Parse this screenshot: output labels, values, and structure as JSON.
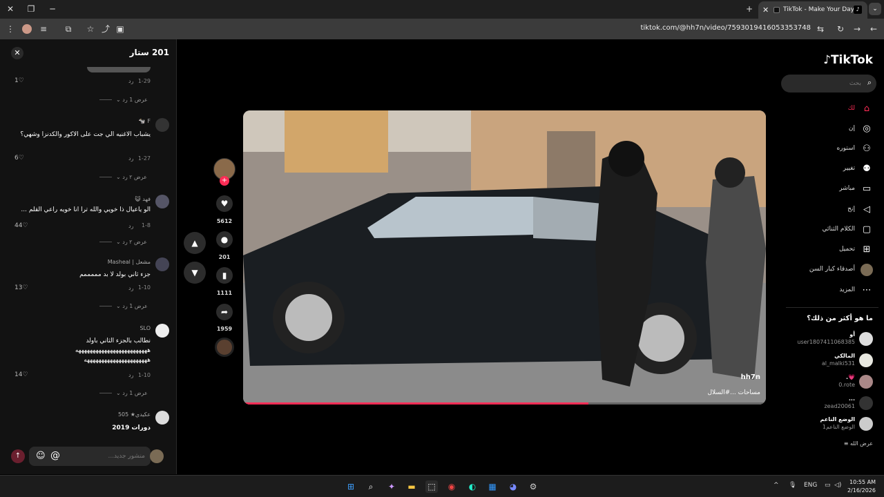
{
  "browser": {
    "tab_title": "TikTok - Make Your Day",
    "url": "tiktok.com/@hh7n/video/7593019416053353748"
  },
  "comments_panel": {
    "title": "201 ستار",
    "items": [
      {
        "author": "",
        "text": "",
        "date": "1-29",
        "reply": "رد",
        "likes": "1",
        "more": "عرض 1 رد"
      },
      {
        "author": "F 🐄",
        "text": "يشباب الاغنيه الي جت على الاكور والكدنزا وشهي؟",
        "date": "1-27",
        "reply": "رد",
        "likes": "6",
        "more": "عرض ٢ رد"
      },
      {
        "author": "فهد 😺",
        "text": "الو ياعيال ذا خويي والله ترا انا خويه راعي القلم ...",
        "date": "1-8",
        "reply": "رد",
        "likes": "44",
        "more": "عرض ٢ رد"
      },
      {
        "author": "مشعل | Masheal",
        "text": "جزء ثاني بولد لا بد مممممم",
        "date": "1-10",
        "reply": "رد",
        "likes": "13",
        "more": "عرض 1 رد"
      },
      {
        "author": "SLO",
        "text": "نطالب بالجزء الثاني باولد هههههههههههههههههههههههههه ههههههههههههههههههههههه",
        "date": "1-10",
        "reply": "رد",
        "likes": "14",
        "more": "عرض 1 رد"
      },
      {
        "author": "عكيدي★ 505",
        "text": "دورات 2019",
        "date": "",
        "reply": "",
        "likes": "",
        "more": ""
      }
    ],
    "composer_placeholder": "منشور جديد...",
    "at_symbol": "@"
  },
  "video": {
    "username": "hh7n",
    "caption": "مساحات ...#السلال"
  },
  "actions": {
    "likes": "5612",
    "comments": "201",
    "saves": "1111",
    "shares": "1959"
  },
  "sidebar": {
    "logo": "TikTok",
    "search_placeholder": "بحث",
    "nav": [
      {
        "label": "لك",
        "icon": "home-icon"
      },
      {
        "label": "إن",
        "icon": "explore-icon"
      },
      {
        "label": "استوره",
        "icon": "following-icon"
      },
      {
        "label": "تغيير",
        "icon": "friends-icon"
      },
      {
        "label": "مباشر",
        "icon": "live-icon"
      },
      {
        "label": "إنج",
        "icon": "messages-icon"
      },
      {
        "label": "الكلام الثنائي",
        "icon": "activity-icon"
      },
      {
        "label": "تحميل",
        "icon": "upload-icon"
      },
      {
        "label": "أصدقاء كبار السن",
        "icon": "profile-icon"
      },
      {
        "label": "المزيد",
        "icon": "more-icon"
      }
    ],
    "following_title": "ما هو أكثر من ذلك؟",
    "following": [
      {
        "name": "أو",
        "id": "user1807411068385"
      },
      {
        "name": "المالكي",
        "id": "al_malki531"
      },
      {
        "name": "💗.",
        "id": "0.rote"
      },
      {
        "name": "...",
        "id": "zead20061"
      },
      {
        "name": "الوضع الناعم",
        "id": "الوضع الناعم1"
      }
    ],
    "more_label": "عرض الله"
  },
  "taskbar": {
    "lang": "ENG",
    "time": "10:55 AM",
    "date": "2/16/2026"
  },
  "colors": {
    "accent": "#fe2c55",
    "background": "#000000",
    "panel": "#121212"
  }
}
